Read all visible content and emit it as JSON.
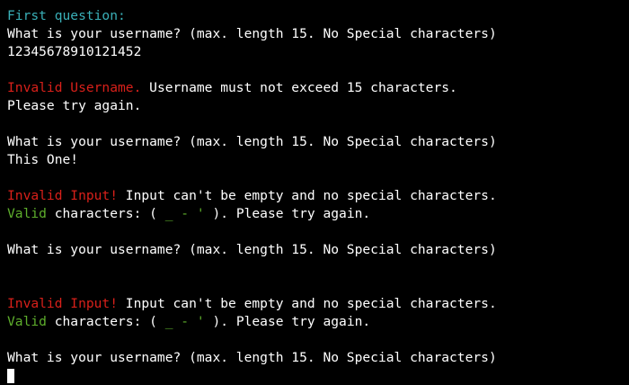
{
  "terminal": {
    "colors": {
      "background": "#000000",
      "default_text": "#ffffff",
      "heading": "#3ab0b8",
      "error": "#d8201a",
      "valid": "#5eae2c"
    },
    "lines": [
      {
        "segments": [
          {
            "text": "First question:",
            "color": "cyan"
          }
        ]
      },
      {
        "segments": [
          {
            "text": "What is your username? (max. length 15. No Special characters)",
            "color": "white"
          }
        ]
      },
      {
        "segments": [
          {
            "text": "12345678910121452",
            "color": "white"
          }
        ]
      },
      {
        "segments": []
      },
      {
        "segments": [
          {
            "text": "Invalid Username.",
            "color": "red"
          },
          {
            "text": " Username must not exceed 15 characters.",
            "color": "white"
          }
        ]
      },
      {
        "segments": [
          {
            "text": "Please try again.",
            "color": "white"
          }
        ]
      },
      {
        "segments": []
      },
      {
        "segments": [
          {
            "text": "What is your username? (max. length 15. No Special characters)",
            "color": "white"
          }
        ]
      },
      {
        "segments": [
          {
            "text": "This One!",
            "color": "white"
          }
        ]
      },
      {
        "segments": []
      },
      {
        "segments": [
          {
            "text": "Invalid Input!",
            "color": "red"
          },
          {
            "text": " Input can't be empty and no special characters.",
            "color": "white"
          }
        ]
      },
      {
        "segments": [
          {
            "text": "Valid",
            "color": "green"
          },
          {
            "text": " characters: ( ",
            "color": "white"
          },
          {
            "text": "_ - '",
            "color": "green"
          },
          {
            "text": " ). Please try again.",
            "color": "white"
          }
        ]
      },
      {
        "segments": []
      },
      {
        "segments": [
          {
            "text": "What is your username? (max. length 15. No Special characters)",
            "color": "white"
          }
        ]
      },
      {
        "segments": []
      },
      {
        "segments": []
      },
      {
        "segments": [
          {
            "text": "Invalid Input!",
            "color": "red"
          },
          {
            "text": " Input can't be empty and no special characters.",
            "color": "white"
          }
        ]
      },
      {
        "segments": [
          {
            "text": "Valid",
            "color": "green"
          },
          {
            "text": " characters: ( ",
            "color": "white"
          },
          {
            "text": "_ - '",
            "color": "green"
          },
          {
            "text": " ). Please try again.",
            "color": "white"
          }
        ]
      },
      {
        "segments": []
      },
      {
        "segments": [
          {
            "text": "What is your username? (max. length 15. No Special characters)",
            "color": "white"
          }
        ]
      }
    ]
  }
}
